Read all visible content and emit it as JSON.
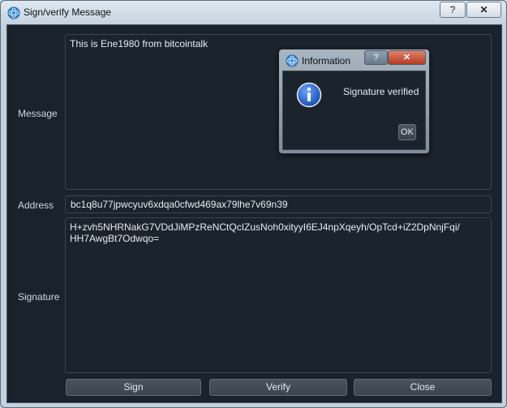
{
  "window": {
    "title": "Sign/verify Message",
    "help_button": "?",
    "close_button": "✕",
    "icon": "app-logo-icon"
  },
  "form": {
    "message_label": "Message",
    "message_value": "This is Ene1980 from bitcointalk",
    "address_label": "Address",
    "address_value": "bc1q8u77jpwcyuv6xdqa0cfwd469ax79lhe7v69n39",
    "signature_label": "Signature",
    "signature_value": "H+zvh5NHRNakG7VDdJiMPzReNCtQcIZusNoh0xityyI6EJ4npXqeyh/OpTcd+iZ2DpNnjFqi/\nHH7AwgBt7Odwqo="
  },
  "buttons": {
    "sign": "Sign",
    "verify": "Verify",
    "close": "Close"
  },
  "dialog": {
    "title": "Information",
    "help_button": "?",
    "close_button": "✕",
    "message": "Signature verified",
    "ok": "OK",
    "icon": "info-icon"
  },
  "colors": {
    "client_bg": "#1a222b",
    "info_blue": "#2a62c8"
  }
}
